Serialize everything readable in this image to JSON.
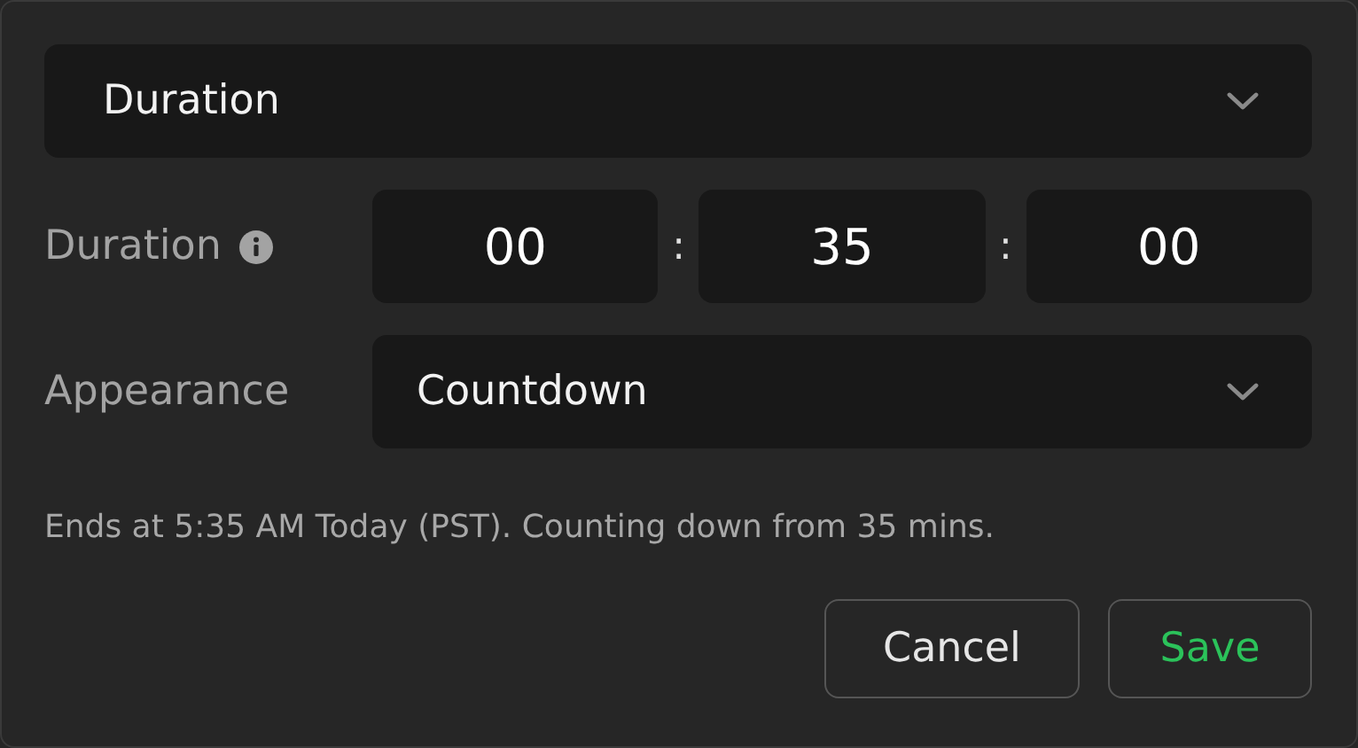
{
  "mode_select": {
    "value": "Duration"
  },
  "duration": {
    "label": "Duration",
    "fields": [
      {
        "value": "00"
      },
      {
        "value": "35"
      },
      {
        "value": "00"
      }
    ],
    "separator": ":"
  },
  "appearance": {
    "label": "Appearance",
    "value": "Countdown"
  },
  "note": "Ends at 5:35 AM Today (PST). Counting down from 35 mins.",
  "buttons": [
    {
      "label": "Cancel",
      "kind": "secondary"
    },
    {
      "label": "Save",
      "kind": "primary"
    }
  ]
}
